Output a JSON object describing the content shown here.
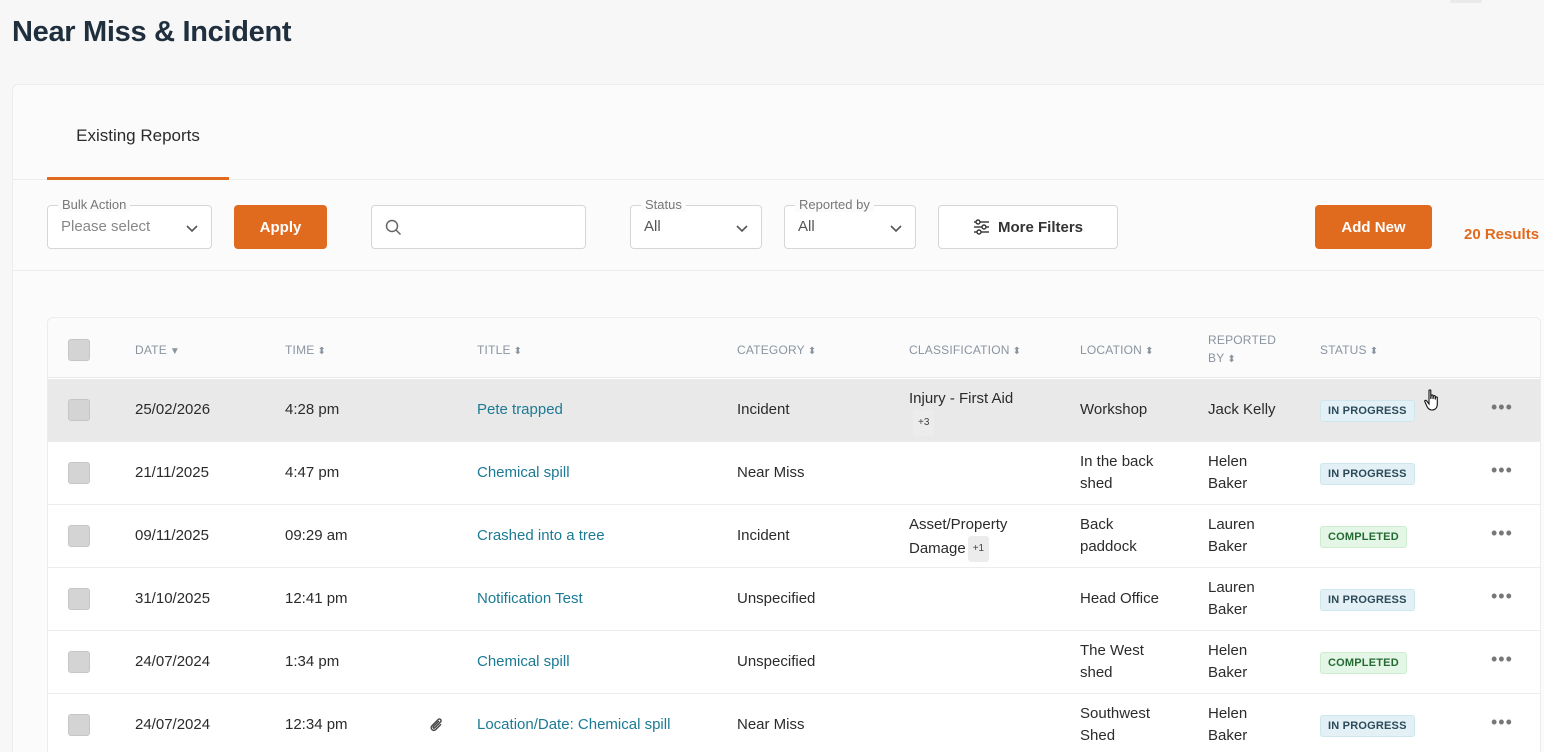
{
  "page": {
    "title": "Near Miss & Incident"
  },
  "tabs": [
    {
      "label": "Existing Reports",
      "active": true
    }
  ],
  "filters": {
    "bulk_action": {
      "label": "Bulk Action",
      "placeholder": "Please select"
    },
    "apply_label": "Apply",
    "search": {
      "placeholder": ""
    },
    "status": {
      "label": "Status",
      "value": "All"
    },
    "reported_by": {
      "label": "Reported by",
      "value": "All"
    },
    "more_filters_label": "More Filters",
    "add_new_label": "Add New",
    "results": "20 Results"
  },
  "colors": {
    "accent": "#e06a1d",
    "link": "#1c7a94"
  },
  "table": {
    "columns": {
      "date": "DATE",
      "time": "TIME",
      "title": "TITLE",
      "category": "CATEGORY",
      "classification": "CLASSIFICATION",
      "location": "LOCATION",
      "reported_by_1": "REPORTED",
      "reported_by_2": "BY",
      "status": "STATUS"
    },
    "rows": [
      {
        "date": "25/02/2026",
        "time": "4:28 pm",
        "title": "Pete trapped",
        "category": "Incident",
        "classification": "Injury - First Aid",
        "classification_extra": "+3",
        "location_1": "Workshop",
        "location_2": "",
        "reporter_1": "Jack Kelly",
        "reporter_2": "",
        "status": "IN PROGRESS",
        "status_type": "progress",
        "attachment": false
      },
      {
        "date": "21/11/2025",
        "time": "4:47 pm",
        "title": "Chemical spill",
        "category": "Near Miss",
        "classification": "",
        "classification_extra": "",
        "location_1": "In the back",
        "location_2": "shed",
        "reporter_1": "Helen",
        "reporter_2": "Baker",
        "status": "IN PROGRESS",
        "status_type": "progress",
        "attachment": false
      },
      {
        "date": "09/11/2025",
        "time": "09:29 am",
        "title": "Crashed into a tree",
        "category": "Incident",
        "classification": "Asset/Property",
        "classification_2": "Damage",
        "classification_extra": "+1",
        "location_1": "Back",
        "location_2": "paddock",
        "reporter_1": "Lauren",
        "reporter_2": "Baker",
        "status": "COMPLETED",
        "status_type": "completed",
        "attachment": false
      },
      {
        "date": "31/10/2025",
        "time": "12:41 pm",
        "title": "Notification Test",
        "category": "Unspecified",
        "classification": "",
        "classification_extra": "",
        "location_1": "Head Office",
        "location_2": "",
        "reporter_1": "Lauren",
        "reporter_2": "Baker",
        "status": "IN PROGRESS",
        "status_type": "progress",
        "attachment": false
      },
      {
        "date": "24/07/2024",
        "time": "1:34 pm",
        "title": "Chemical spill",
        "category": "Unspecified",
        "classification": "",
        "classification_extra": "",
        "location_1": "The West",
        "location_2": "shed",
        "reporter_1": "Helen",
        "reporter_2": "Baker",
        "status": "COMPLETED",
        "status_type": "completed",
        "attachment": false
      },
      {
        "date": "24/07/2024",
        "time": "12:34 pm",
        "title": "Location/Date: Chemical spill",
        "category": "Near Miss",
        "classification": "",
        "classification_extra": "",
        "location_1": "Southwest",
        "location_2": "Shed",
        "reporter_1": "Helen",
        "reporter_2": "Baker",
        "status": "IN PROGRESS",
        "status_type": "progress",
        "attachment": true
      }
    ],
    "more_glyph": "•••"
  }
}
